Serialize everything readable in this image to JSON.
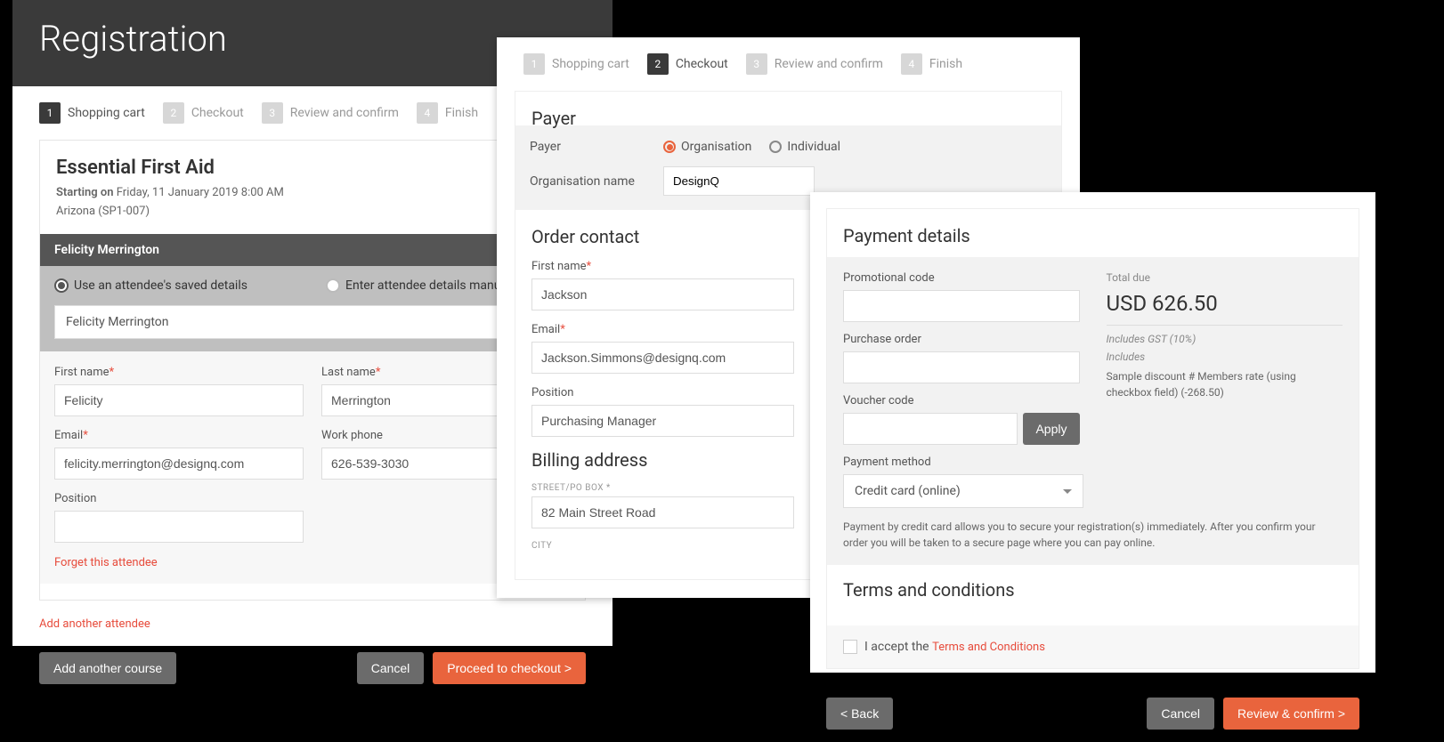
{
  "steps": [
    "Shopping cart",
    "Checkout",
    "Review and confirm",
    "Finish"
  ],
  "panel1": {
    "title": "Registration",
    "course_title": "Essential First Aid",
    "starting_on": "Starting on",
    "start_val": "Friday, 11 January 2019 8:00 AM",
    "location": "Arizona (SP1-007)",
    "attendee_name": "Felicity Merrington",
    "radio_saved": "Use an attendee's saved details",
    "radio_manual": "Enter attendee details manually",
    "select_attendee": "Felicity Merrington",
    "lbl_first": "First name",
    "lbl_last": "Last name",
    "lbl_email": "Email",
    "lbl_work": "Work phone",
    "lbl_pos": "Position",
    "val_first": "Felicity",
    "val_last": "Merrington",
    "val_email": "felicity.merrington@designq.com",
    "val_work": "626-539-3030",
    "forget": "Forget this attendee",
    "add_attendee": "Add another attendee",
    "btn_add_course": "Add another course",
    "btn_cancel": "Cancel",
    "btn_proceed": "Proceed to checkout >"
  },
  "panel2": {
    "h_payer": "Payer",
    "lbl_payer": "Payer",
    "opt_org": "Organisation",
    "opt_ind": "Individual",
    "lbl_org": "Organisation name",
    "val_org": "DesignQ",
    "h_contact": "Order contact",
    "lbl_first": "First name",
    "val_first": "Jackson",
    "lbl_email": "Email",
    "val_email": "Jackson.Simmons@designq.com",
    "lbl_pos": "Position",
    "val_pos": "Purchasing Manager",
    "h_billing": "Billing address",
    "lbl_street": "STREET/PO BOX",
    "val_street": "82 Main Street Road",
    "lbl_city": "CITY"
  },
  "panel3": {
    "h_payment": "Payment details",
    "lbl_promo": "Promotional code",
    "lbl_po": "Purchase order",
    "lbl_voucher": "Voucher code",
    "btn_apply": "Apply",
    "lbl_method": "Payment method",
    "val_method": "Credit card (online)",
    "lbl_total": "Total due",
    "total": "USD 626.50",
    "gst": "Includes GST (10%)",
    "includes": "Includes",
    "inc_detail": "Sample discount # Members rate (using checkbox field) (-268.50)",
    "note": "Payment by credit card allows you to secure your registration(s) immediately. After you confirm your order you will be taken to a secure page where you can pay online.",
    "h_terms": "Terms and conditions",
    "terms_prefix": "I accept the ",
    "terms_link": "Terms and Conditions",
    "btn_back": "< Back",
    "btn_cancel": "Cancel",
    "btn_review": "Review & confirm >"
  }
}
